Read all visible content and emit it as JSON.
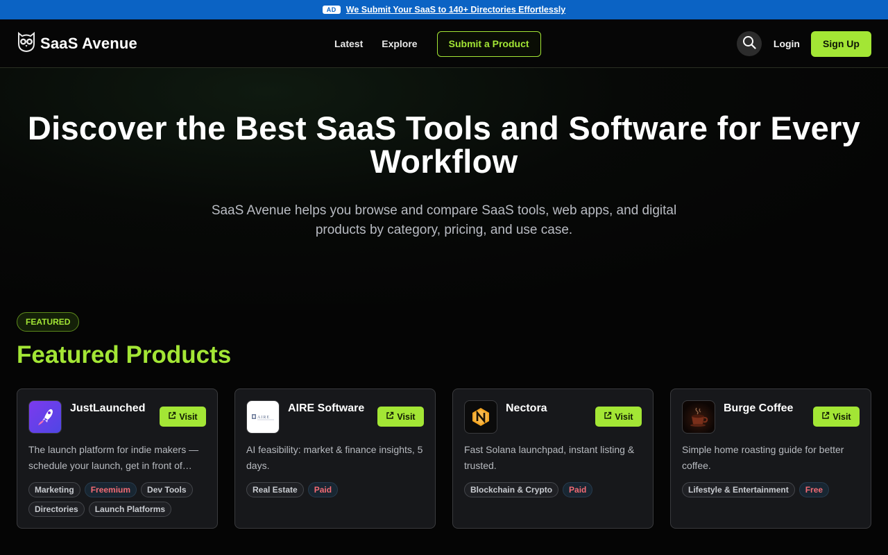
{
  "ad": {
    "badge": "AD",
    "text": "We Submit Your SaaS to 140+ Directories Effortlessly"
  },
  "header": {
    "brand": "SaaS Avenue",
    "nav": {
      "latest": "Latest",
      "explore": "Explore",
      "submit": "Submit a Product"
    },
    "login": "Login",
    "signup": "Sign Up"
  },
  "hero": {
    "title": "Discover the Best SaaS Tools and Software for Every Workflow",
    "subtitle": "SaaS Avenue helps you browse and compare SaaS tools, web apps, and digital products by category, pricing, and use case."
  },
  "featured": {
    "badge": "FEATURED",
    "title": "Featured Products",
    "visit_label": "Visit",
    "cards": [
      {
        "name": "JustLaunched",
        "desc": "The launch platform for indie makers — schedule your launch, get in front of…",
        "logo": "rocket-icon",
        "tags": [
          "Marketing",
          "Freemium",
          "Dev Tools",
          "Directories",
          "Launch Platforms"
        ],
        "price_index": 1
      },
      {
        "name": "AIRE Software",
        "desc": "AI feasibility: market & finance insights, 5 days.",
        "logo": "aire-logo",
        "tags": [
          "Real Estate",
          "Paid"
        ],
        "price_index": 1
      },
      {
        "name": "Nectora",
        "desc": "Fast Solana launchpad, instant listing & trusted.",
        "logo": "nectora-logo",
        "tags": [
          "Blockchain & Crypto",
          "Paid"
        ],
        "price_index": 1
      },
      {
        "name": "Burge Coffee",
        "desc": "Simple home roasting guide for better coffee.",
        "logo": "coffee-cup-icon",
        "tags": [
          "Lifestyle & Entertainment",
          "Free"
        ],
        "price_index": 1
      }
    ]
  },
  "colors": {
    "accent": "#a3e635",
    "ad_bar": "#0b63c4",
    "price_tag": "#f26b74"
  }
}
